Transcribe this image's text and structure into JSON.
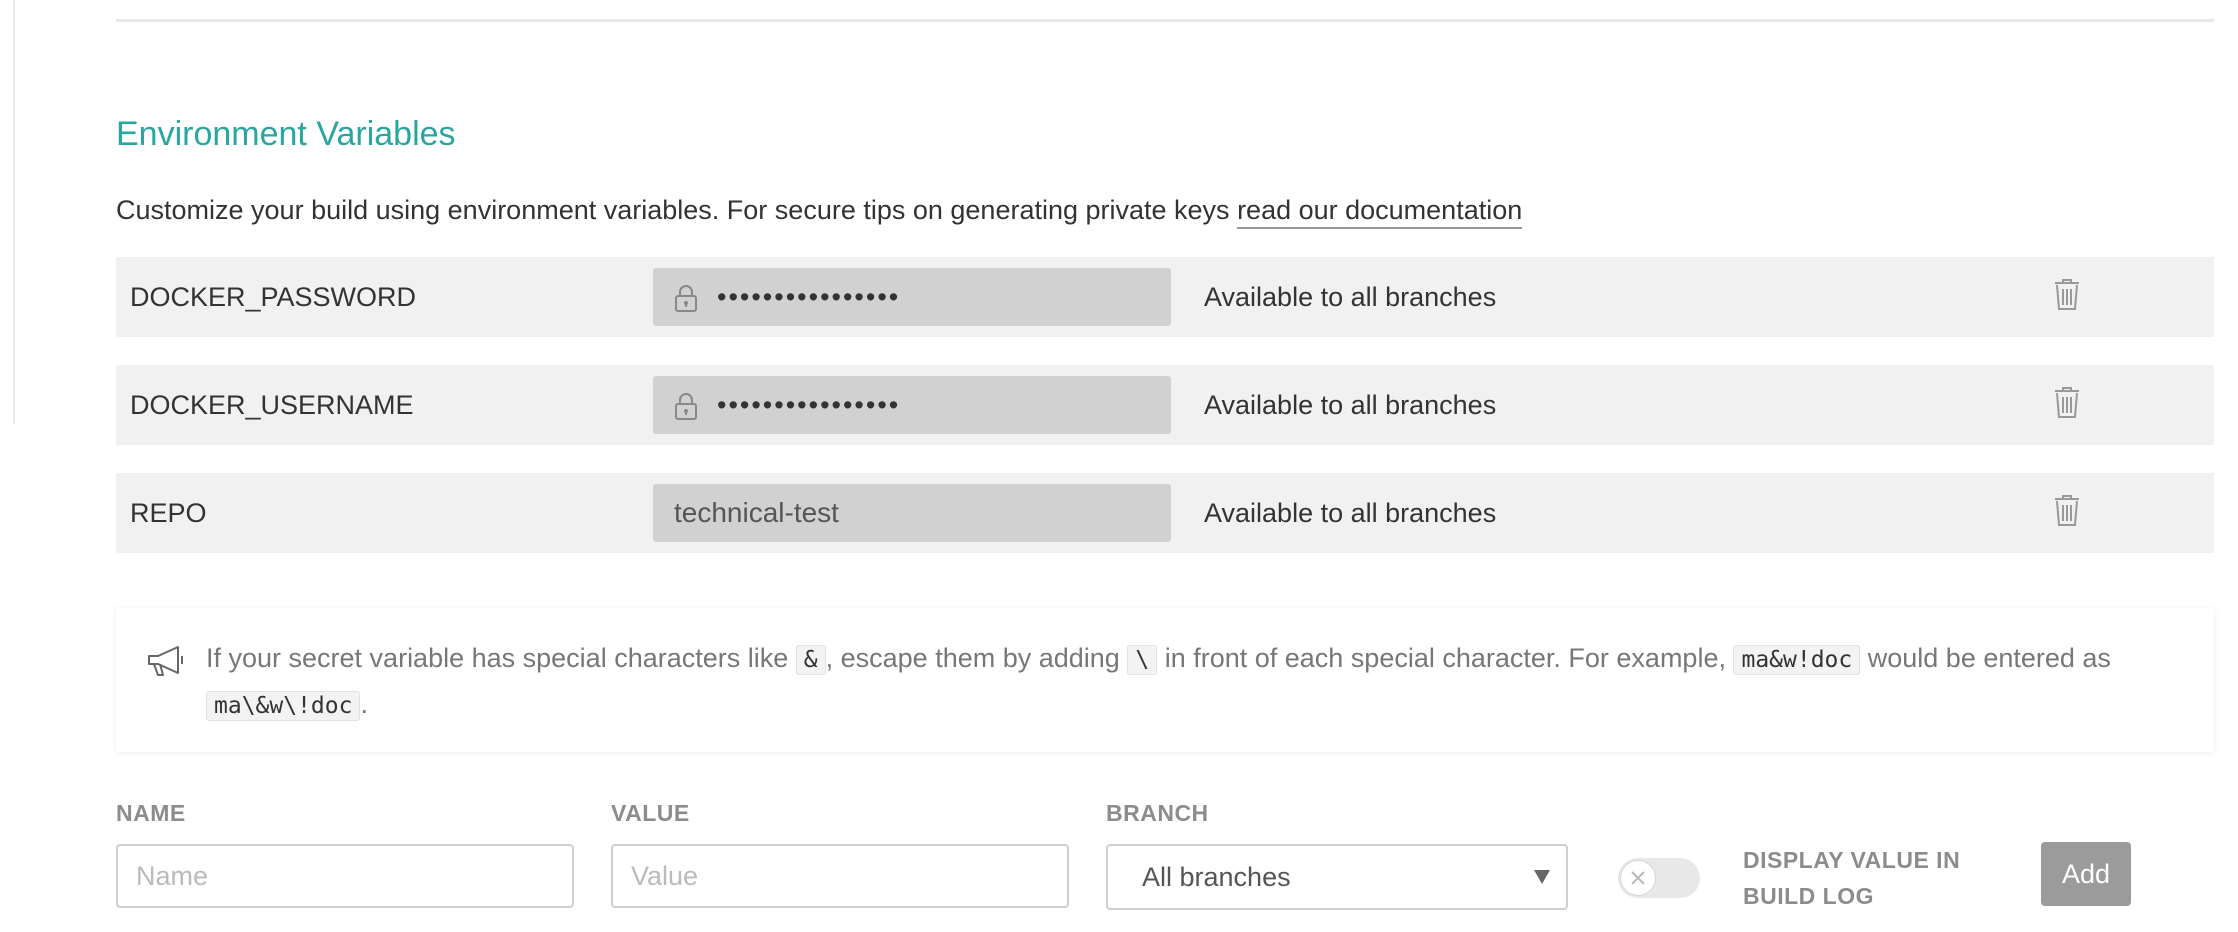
{
  "section": {
    "title": "Environment Variables",
    "intro_text": "Customize your build using environment variables. For secure tips on generating private keys ",
    "intro_link": "read our documentation"
  },
  "env_vars": [
    {
      "name": "DOCKER_PASSWORD",
      "value": "••••••••••••••••",
      "secret": true,
      "branch": "Available to all branches"
    },
    {
      "name": "DOCKER_USERNAME",
      "value": "••••••••••••••••",
      "secret": true,
      "branch": "Available to all branches"
    },
    {
      "name": "REPO",
      "value": "technical-test",
      "secret": false,
      "branch": "Available to all branches"
    }
  ],
  "notice": {
    "text_1": "If your secret variable has special characters like ",
    "code_1": "&",
    "text_2": ", escape them by adding ",
    "code_2": "\\",
    "text_3": " in front of each special character. For example, ",
    "code_3": "ma&w!doc",
    "text_4": " would be entered as ",
    "code_4": "ma\\&w\\!doc",
    "text_5": "."
  },
  "form": {
    "name_label": "NAME",
    "name_placeholder": "Name",
    "value_label": "VALUE",
    "value_placeholder": "Value",
    "branch_label": "BRANCH",
    "branch_selected": "All branches",
    "display_toggle_on": false,
    "display_label": "DISPLAY VALUE IN BUILD LOG",
    "add_label": "Add"
  },
  "colors": {
    "accent": "#2aa6a0",
    "row_bg": "#f1f1f1",
    "value_bg": "#d1d1d1",
    "button_bg": "#9b9b9b"
  }
}
